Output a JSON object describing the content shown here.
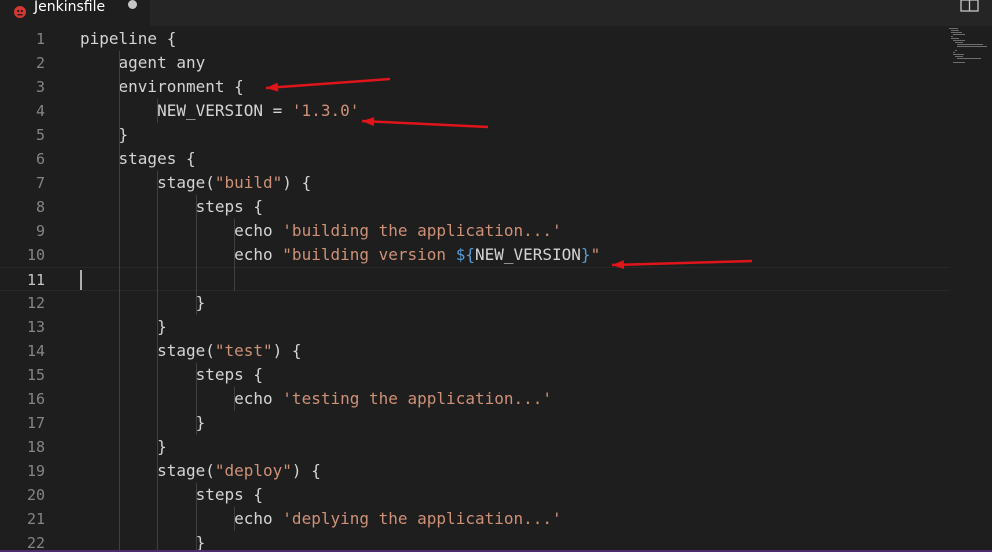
{
  "tab": {
    "filename": "Jenkinsfile",
    "icon": "jenkins-file-icon",
    "modified": true
  },
  "editor": {
    "current_line": 11,
    "lines": [
      {
        "n": "1",
        "tokens": [
          {
            "t": "pipeline {",
            "c": "plain"
          }
        ]
      },
      {
        "n": "2",
        "tokens": [
          {
            "t": "    agent any",
            "c": "plain"
          }
        ]
      },
      {
        "n": "3",
        "tokens": [
          {
            "t": "    environment {",
            "c": "plain"
          }
        ]
      },
      {
        "n": "4",
        "tokens": [
          {
            "t": "        NEW_VERSION = ",
            "c": "plain"
          },
          {
            "t": "'1.3.0'",
            "c": "str"
          }
        ]
      },
      {
        "n": "5",
        "tokens": [
          {
            "t": "    }",
            "c": "plain"
          }
        ]
      },
      {
        "n": "6",
        "tokens": [
          {
            "t": "    stages {",
            "c": "plain"
          }
        ]
      },
      {
        "n": "7",
        "tokens": [
          {
            "t": "        stage(",
            "c": "plain"
          },
          {
            "t": "\"build\"",
            "c": "str"
          },
          {
            "t": ") {",
            "c": "plain"
          }
        ]
      },
      {
        "n": "8",
        "tokens": [
          {
            "t": "            steps {",
            "c": "plain"
          }
        ]
      },
      {
        "n": "9",
        "tokens": [
          {
            "t": "                echo ",
            "c": "plain"
          },
          {
            "t": "'building the application...'",
            "c": "str"
          }
        ]
      },
      {
        "n": "10",
        "tokens": [
          {
            "t": "                echo ",
            "c": "plain"
          },
          {
            "t": "\"building version ",
            "c": "str"
          },
          {
            "t": "${",
            "c": "interp"
          },
          {
            "t": "NEW_VERSION",
            "c": "plain"
          },
          {
            "t": "}",
            "c": "interp"
          },
          {
            "t": "\"",
            "c": "str"
          }
        ]
      },
      {
        "n": "11",
        "tokens": [
          {
            "t": "",
            "c": "plain"
          }
        ]
      },
      {
        "n": "12",
        "tokens": [
          {
            "t": "            }",
            "c": "plain"
          }
        ]
      },
      {
        "n": "13",
        "tokens": [
          {
            "t": "        }",
            "c": "plain"
          }
        ]
      },
      {
        "n": "14",
        "tokens": [
          {
            "t": "        stage(",
            "c": "plain"
          },
          {
            "t": "\"test\"",
            "c": "str"
          },
          {
            "t": ") {",
            "c": "plain"
          }
        ]
      },
      {
        "n": "15",
        "tokens": [
          {
            "t": "            steps {",
            "c": "plain"
          }
        ]
      },
      {
        "n": "16",
        "tokens": [
          {
            "t": "                echo ",
            "c": "plain"
          },
          {
            "t": "'testing the application...'",
            "c": "str"
          }
        ]
      },
      {
        "n": "17",
        "tokens": [
          {
            "t": "            }",
            "c": "plain"
          }
        ]
      },
      {
        "n": "18",
        "tokens": [
          {
            "t": "        }",
            "c": "plain"
          }
        ]
      },
      {
        "n": "19",
        "tokens": [
          {
            "t": "        stage(",
            "c": "plain"
          },
          {
            "t": "\"deploy\"",
            "c": "str"
          },
          {
            "t": ") {",
            "c": "plain"
          }
        ]
      },
      {
        "n": "20",
        "tokens": [
          {
            "t": "            steps {",
            "c": "plain"
          }
        ]
      },
      {
        "n": "21",
        "tokens": [
          {
            "t": "                echo ",
            "c": "plain"
          },
          {
            "t": "'deplying the application...'",
            "c": "str"
          }
        ]
      },
      {
        "n": "22",
        "tokens": [
          {
            "t": "            }",
            "c": "plain"
          }
        ]
      }
    ]
  },
  "annotation_color": "#e0141b",
  "theme": {
    "background": "#1e1e1e",
    "text": "#d4d4d4",
    "string": "#ce9178",
    "interpolation": "#569cd6"
  }
}
